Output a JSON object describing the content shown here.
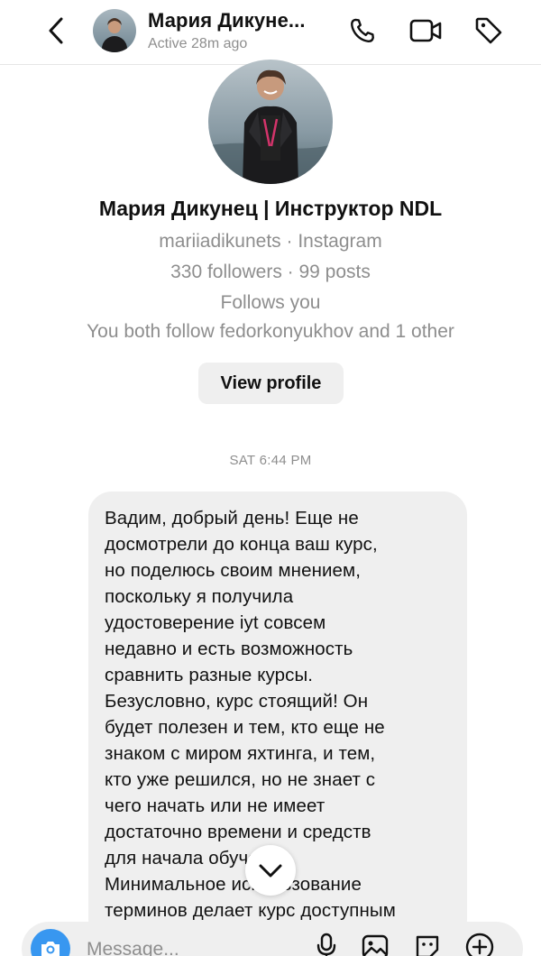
{
  "header": {
    "name": "Мария Дикуне...",
    "status": "Active 28m ago"
  },
  "profile": {
    "name": "Мария Дикунец | Инструктор NDL",
    "handle_line": "mariiadikunets · Instagram",
    "stats_line": "330 followers · 99 posts",
    "follows_line": "Follows you",
    "mutual_line": "You both follow fedorkonyukhov and 1 other",
    "view_profile_label": "View profile"
  },
  "thread": {
    "timestamp": "SAT 6:44 PM",
    "message": "Вадим, добрый день! Еще не\nдосмотрели до конца ваш курс,\nно поделюсь своим мнением,\nпоскольку я получила\nудостоверение iyt совсем\nнедавно и есть возможность\nсравнить разные курсы.\nБезусловно, курс стоящий! Он\nбудет полезен и тем, кто еще не\nзнаком с миром яхтинга, и тем,\nкто уже решился, но не знает с\nчего начать или не имеет\nдостаточно времени и средств\nдля начала обучения.\nМинимальное использование\nтерминов делает курс доступным"
  },
  "composer": {
    "placeholder": "Message..."
  },
  "icons": {
    "back": "chevron-left-icon",
    "phone": "phone-icon",
    "video": "video-camera-icon",
    "tag": "tag-icon",
    "scroll": "chevron-down-icon",
    "camera": "camera-icon",
    "mic": "microphone-icon",
    "gallery": "image-icon",
    "sticker": "sticker-icon",
    "plus": "plus-circle-icon"
  },
  "colors": {
    "accent": "#3897f0",
    "bubble": "#efefef",
    "secondary_text": "#8e8e8e"
  }
}
